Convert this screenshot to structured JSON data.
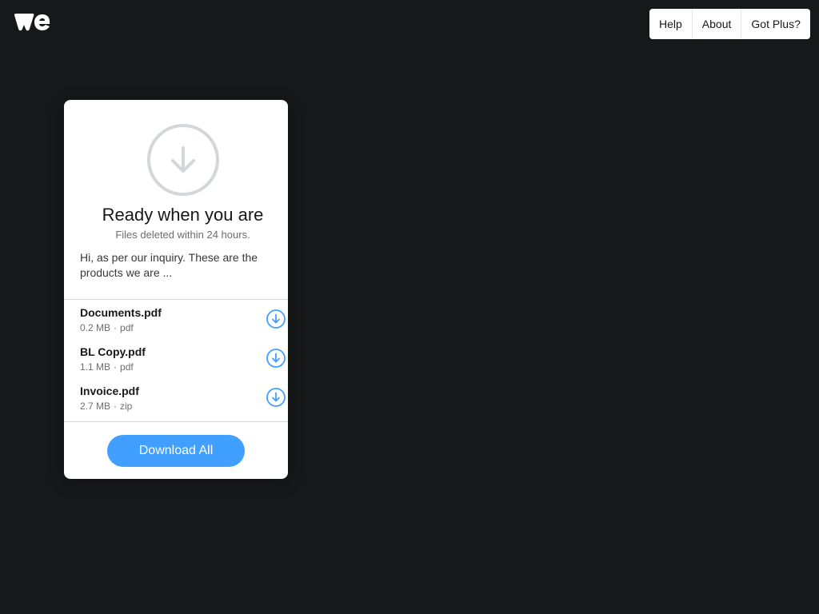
{
  "brand": {
    "logo_icon": "wetransfer-logo-icon"
  },
  "nav": {
    "items": [
      {
        "label": "Help"
      },
      {
        "label": "About"
      },
      {
        "label": "Got Plus?"
      }
    ]
  },
  "card": {
    "hero_icon": "download-circle-icon",
    "title": "Ready when you are",
    "subtitle": "Files deleted within 24 hours.",
    "message": "Hi, as per our inquiry. These are the products we are ...",
    "files": [
      {
        "name": "Documents.pdf",
        "size": "0.2 MB",
        "type": "pdf"
      },
      {
        "name": "BL Copy.pdf",
        "size": "1.1 MB",
        "type": "pdf"
      },
      {
        "name": "Invoice.pdf",
        "size": "2.7 MB",
        "type": "zip"
      }
    ],
    "download_all_label": "Download All"
  },
  "colors": {
    "background": "#17181a",
    "accent": "#409fff",
    "card": "#ffffff"
  }
}
